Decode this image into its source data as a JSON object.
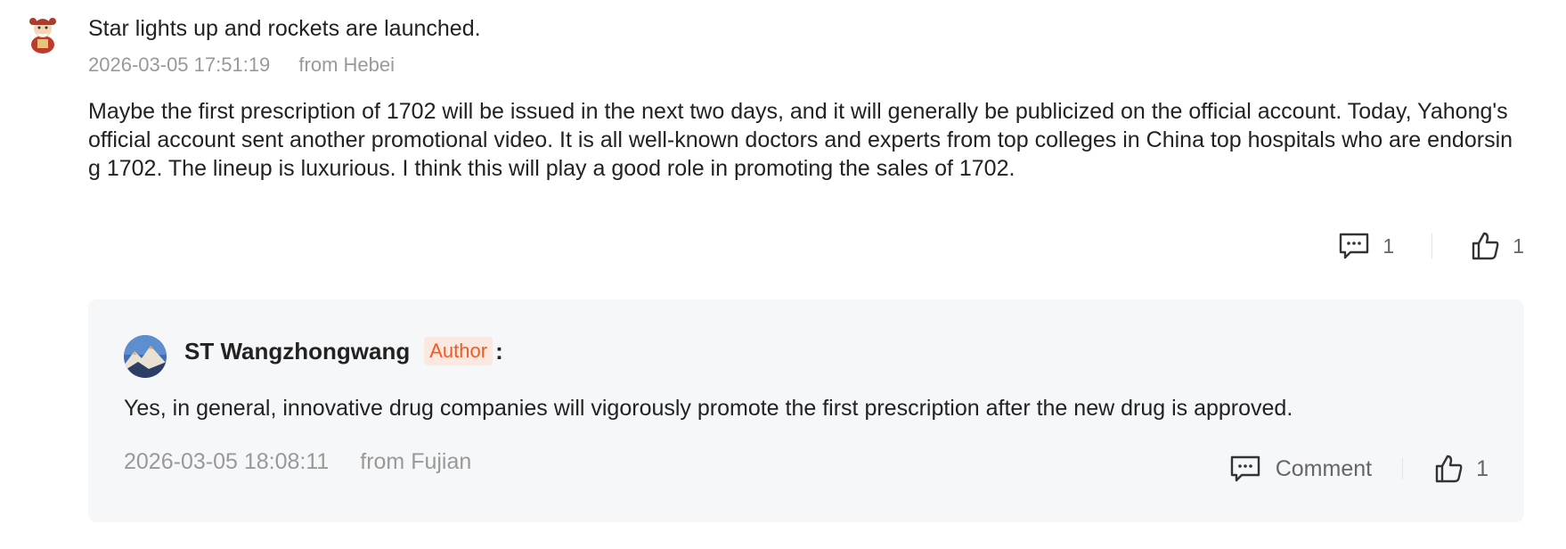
{
  "post": {
    "avatar_icon": "mascot-avatar-icon",
    "title": "Star lights up and rockets are launched.",
    "timestamp": "2026-03-05 17:51:19",
    "location": "from Hebei",
    "body": "Maybe the first prescription of 1702 will be issued in the next two days, and it will generally be publicized on the official account. Today, Yahong's official account sent another promotional video. It is all well-known doctors and experts from top colleges in China top hospitals who are endorsing 1702. The lineup is luxurious. I think this will play a good role in promoting the sales of 1702.",
    "comment_count": "1",
    "like_count": "1"
  },
  "reply": {
    "avatar_icon": "landscape-avatar-icon",
    "author": "ST Wangzhongwang",
    "author_tag": "Author",
    "colon": ":",
    "body": "Yes, in general, innovative drug companies will vigorously promote the first prescription after the new drug is approved.",
    "timestamp": "2026-03-05 18:08:11",
    "location": "from Fujian",
    "comment_label": "Comment",
    "like_count": "1"
  },
  "colors": {
    "accent": "#f05a22",
    "author_tag_bg": "#fbe8e0",
    "reply_bg": "#f6f7f9",
    "meta_text": "#999999"
  }
}
